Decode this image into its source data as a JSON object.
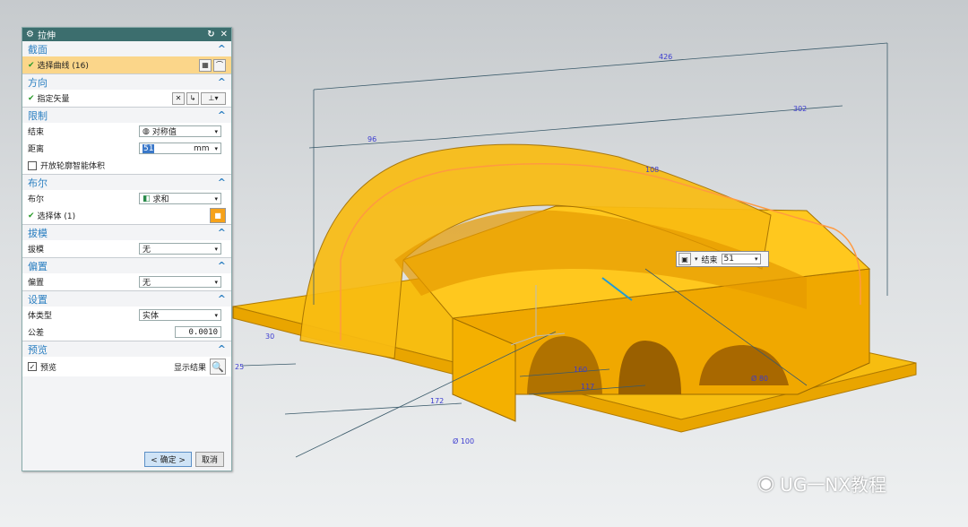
{
  "dialog": {
    "title": "拉伸",
    "sections": {
      "section": {
        "title": "截面",
        "select_curve": "选择曲线 (16)"
      },
      "direction": {
        "title": "方向",
        "specify_vector": "指定矢量"
      },
      "limits": {
        "title": "限制",
        "end_label": "结束",
        "end_value": "对称值",
        "distance_label": "距离",
        "distance_value": "51",
        "distance_unit": "mm",
        "open_profile_label": "开放轮廓智能体积"
      },
      "boolean": {
        "title": "布尔",
        "boolean_label": "布尔",
        "boolean_value": "求和",
        "select_body": "选择体 (1)"
      },
      "draft": {
        "title": "拔模",
        "draft_label": "拔模",
        "draft_value": "无"
      },
      "offset": {
        "title": "偏置",
        "offset_label": "偏置",
        "offset_value": "无"
      },
      "settings": {
        "title": "设置",
        "body_type_label": "体类型",
        "body_type_value": "实体",
        "tolerance_label": "公差",
        "tolerance_value": "0.0010"
      },
      "preview": {
        "title": "预览",
        "preview_label": "预览",
        "show_result": "显示结果"
      }
    },
    "buttons": {
      "ok": "< 确定 >",
      "cancel": "取消"
    }
  },
  "float_toolbar": {
    "label": "结束",
    "value": "51"
  },
  "dimensions": [
    "426",
    "302",
    "96",
    "108",
    "160",
    "117",
    "172",
    "Ø 80",
    "Ø 100",
    "30",
    "25"
  ],
  "watermark": "UG一NX教程",
  "colors": {
    "accent": "#2b7fc1",
    "title_bar": "#3c6e6e",
    "model": "#f5b800",
    "highlight": "#fbd68a"
  }
}
